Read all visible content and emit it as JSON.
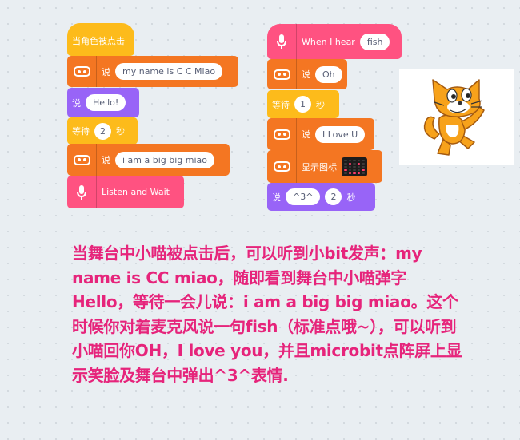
{
  "left_script": {
    "hat_label": "当角色被点击",
    "say1_label": "说",
    "say1_value": "my name is C C Miao",
    "say2_label": "说",
    "say2_value": "Hello!",
    "wait_label": "等待",
    "wait_value": "2",
    "wait_unit": "秒",
    "say3_label": "说",
    "say3_value": "i am a big big miao",
    "listen_label": "Listen and Wait"
  },
  "right_script": {
    "hat_label": "When I hear",
    "hat_value": "fish",
    "say1_label": "说",
    "say1_value": "Oh",
    "wait_label": "等待",
    "wait_value": "1",
    "wait_unit": "秒",
    "say2_label": "说",
    "say2_value": "I Love U",
    "show_icon_label": "显示图标",
    "say3_label": "说",
    "say3_value": "^3^",
    "say3_secs": "2",
    "say3_unit": "秒"
  },
  "icons": {
    "microbit": "microbit-icon",
    "microphone": "microphone-icon",
    "led": "led-matrix-icon",
    "sprite": "scratch-cat"
  },
  "colors": {
    "microbit_block": "#f47622",
    "looks_block": "#9864f7",
    "control_block": "#fdbb1b",
    "sound_block": "#ff5281",
    "description_text": "#e6247b"
  },
  "description": "当舞台中小喵被点击后，可以听到小bit发声：my name is CC miao，随即看到舞台中小喵弹字Hello，等待一会儿说：i am a big big miao。这个时候你对着麦克风说一句fish（标准点哦~），可以听到小喵回你OH，I love you，并且microbit点阵屏上显示笑脸及舞台中弹出^3^表情."
}
